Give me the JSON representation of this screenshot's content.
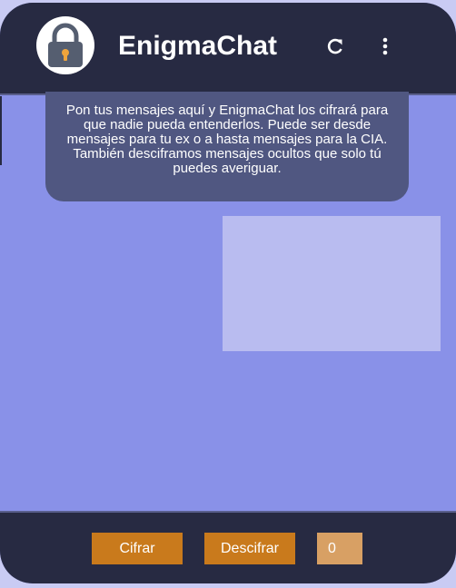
{
  "header": {
    "app_title": "EnigmaChat",
    "logo_icon": "padlock-icon",
    "refresh_icon": "refresh-icon",
    "menu_icon": "more-vertical-icon"
  },
  "info": {
    "text": "Pon tus mensajes aquí y EnigmaChat los cifrará para que nadie pueda entenderlos. Puede ser desde mensajes para tu ex o a hasta mensajes para la CIA. También desciframos mensajes ocultos que solo tú puedes averiguar."
  },
  "message": {
    "text": ""
  },
  "footer": {
    "encrypt_label": "Cifrar",
    "decrypt_label": "Descifrar",
    "counter_value": "0"
  },
  "colors": {
    "header_bg": "#272a42",
    "body_bg": "#8991e8",
    "button_orange": "#c97a1c",
    "counter_bg": "#d8a064"
  }
}
